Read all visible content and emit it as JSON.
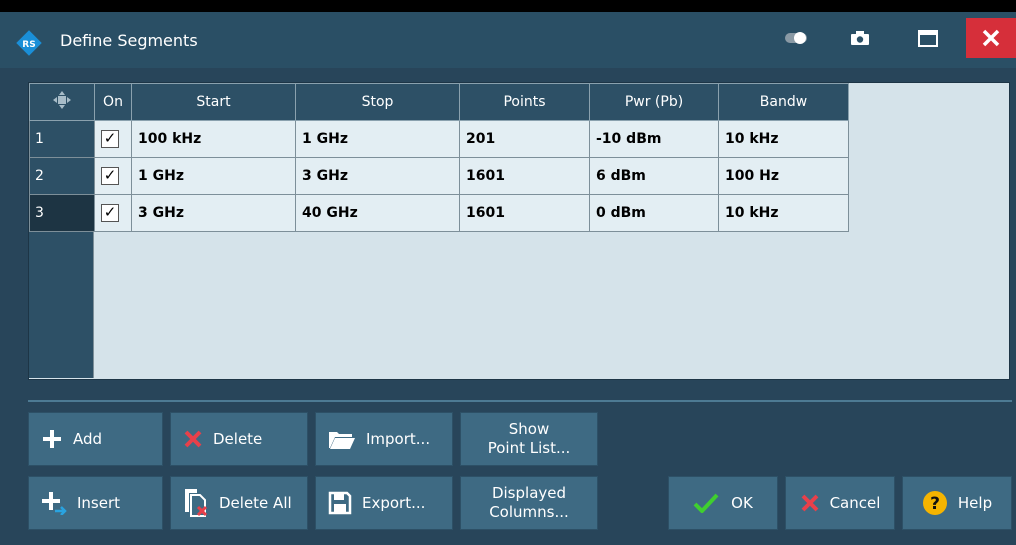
{
  "window": {
    "title": "Define Segments"
  },
  "grid": {
    "headers": [
      "On",
      "Start",
      "Stop",
      "Points",
      "Pwr (Pb)",
      "Bandw"
    ],
    "rows": [
      {
        "num": "1",
        "on": "✓",
        "start": "100 kHz",
        "stop": "1 GHz",
        "points": "201",
        "pwr": "-10 dBm",
        "bandw": "10 kHz"
      },
      {
        "num": "2",
        "on": "✓",
        "start": "1 GHz",
        "stop": "3 GHz",
        "points": "1601",
        "pwr": "6 dBm",
        "bandw": "100 Hz"
      },
      {
        "num": "3",
        "on": "✓",
        "start": "3 GHz",
        "stop": "40 GHz",
        "points": "1601",
        "pwr": "0 dBm",
        "bandw": "10 kHz"
      }
    ]
  },
  "buttons": {
    "add": "Add",
    "delete": "Delete",
    "import": "Import...",
    "show_point_list_1": "Show",
    "show_point_list_2": "Point List...",
    "insert": "Insert",
    "delete_all": "Delete All",
    "export": "Export...",
    "displayed_columns_1": "Displayed",
    "displayed_columns_2": "Columns...",
    "ok": "OK",
    "cancel": "Cancel",
    "help": "Help"
  },
  "colors": {
    "title_bar": "#2a4f65",
    "close": "#d62f3a",
    "button": "#3e6a83",
    "grid_cell": "#e3eef3"
  }
}
